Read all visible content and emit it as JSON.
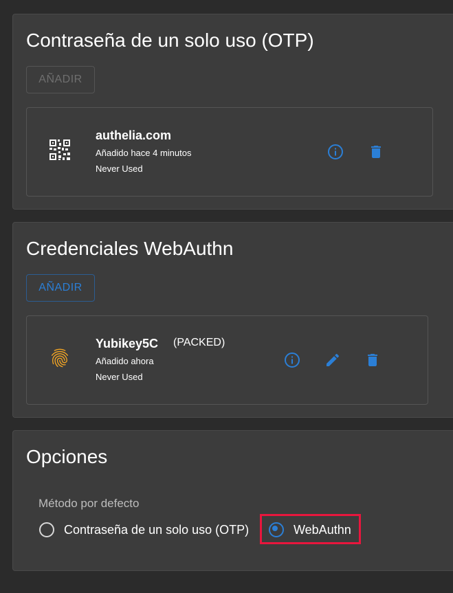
{
  "otp_section": {
    "title": "Contraseña de un solo uso (OTP)",
    "add_label": "AÑADIR",
    "credential": {
      "name": "authelia.com",
      "added": "Añadido hace 4 minutos",
      "last_used": "Never Used",
      "icon": "qr-code-icon"
    }
  },
  "webauthn_section": {
    "title": "Credenciales WebAuthn",
    "add_label": "AÑADIR",
    "credential": {
      "name": "Yubikey5C",
      "type": "(PACKED)",
      "added": "Añadido ahora",
      "last_used": "Never Used",
      "icon": "fingerprint-icon"
    }
  },
  "options_section": {
    "title": "Opciones",
    "default_method_label": "Método por defecto",
    "methods": [
      {
        "label": "Contraseña de un solo uso (OTP)",
        "selected": false
      },
      {
        "label": "WebAuthn",
        "selected": true
      }
    ]
  },
  "colors": {
    "accent": "#2b7fd6",
    "highlight": "#e8163d",
    "fingerprint": "#f5a623",
    "panel": "#3c3c3c",
    "background": "#2b2b2b"
  }
}
